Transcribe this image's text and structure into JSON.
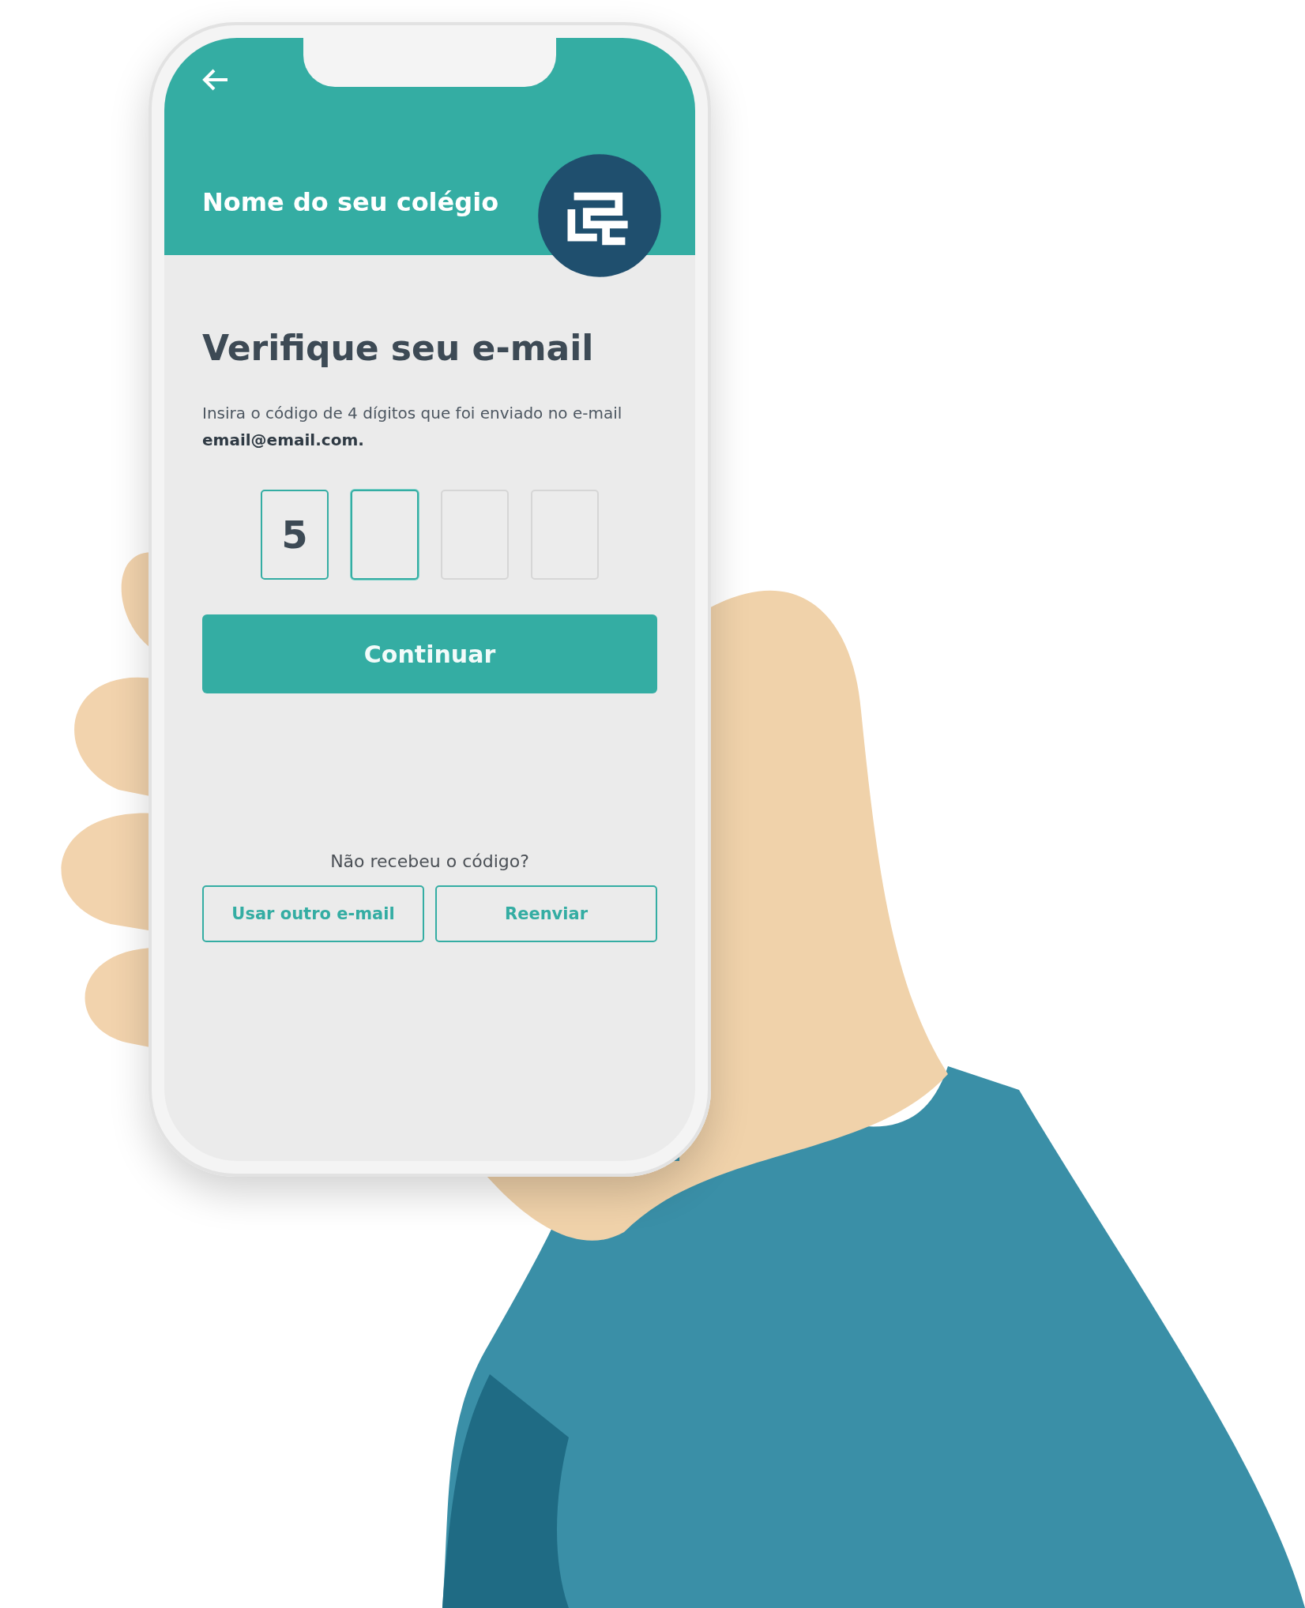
{
  "header": {
    "title": "Nome do seu colégio"
  },
  "content": {
    "heading": "Verifique seu e-mail",
    "description": "Insira o código de 4 dígitos que foi enviado no e-mail **email@email.com.**",
    "code_digits": [
      {
        "value": "5",
        "active": false
      },
      {
        "active": true
      },
      {
        "active": false
      },
      {
        "active": false
      }
    ],
    "continue_button": "Continuar"
  },
  "footer": {
    "prompt": "Não recebeu o código?",
    "buttons": [
      "Usar outro e-mail",
      "Reenviar"
    ]
  }
}
